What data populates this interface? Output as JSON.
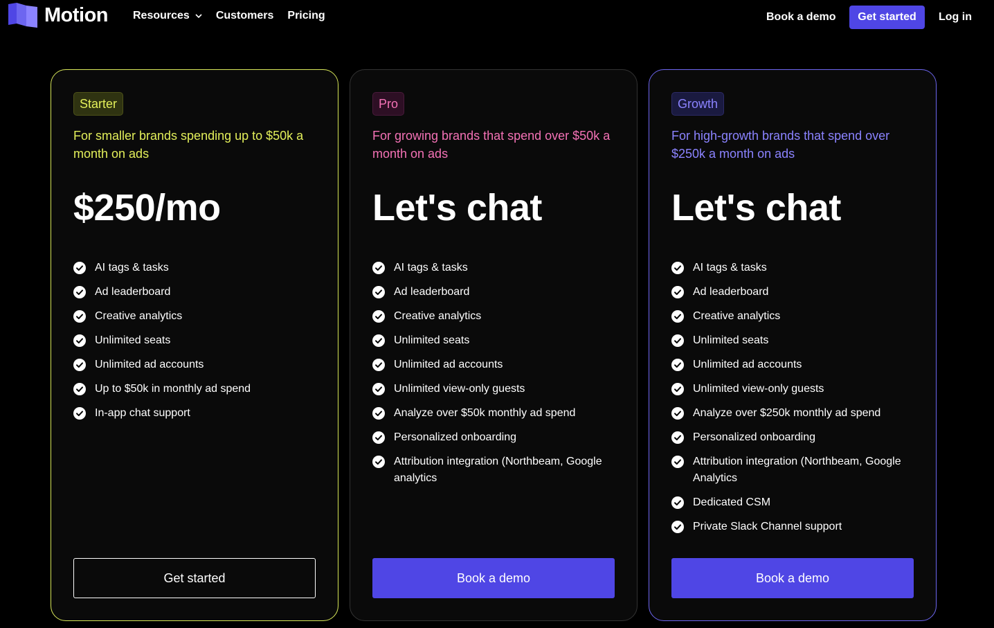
{
  "nav": {
    "logo_text": "Motion",
    "links": [
      {
        "label": "Resources",
        "has_dropdown": true
      },
      {
        "label": "Customers"
      },
      {
        "label": "Pricing"
      }
    ],
    "book_demo": "Book a demo",
    "get_started": "Get started",
    "login": "Log in",
    "accent_color": "#4f46e5"
  },
  "plans": [
    {
      "badge": "Starter",
      "description": "For smaller brands spending up to $50k a month on ads",
      "price": "$250/mo",
      "features": [
        "AI tags & tasks",
        "Ad leaderboard",
        "Creative analytics",
        "Unlimited seats",
        "Unlimited ad accounts",
        "Up to $50k in monthly ad spend",
        "In-app chat support"
      ],
      "cta": "Get started",
      "accent_color": "#e3ef5a"
    },
    {
      "badge": "Pro",
      "description": "For growing brands that spend over $50k a month on ads",
      "price": "Let's chat",
      "features": [
        "AI tags & tasks",
        "Ad leaderboard",
        "Creative analytics",
        "Unlimited seats",
        "Unlimited ad accounts",
        "Unlimited view-only guests",
        "Analyze over $50k monthly ad spend",
        "Personalized onboarding",
        "Attribution integration (Northbeam, Google analytics"
      ],
      "cta": "Book a demo",
      "accent_color": "#f472b6"
    },
    {
      "badge": "Growth",
      "description": "For high-growth brands that spend over $250k a month on ads",
      "price": "Let's chat",
      "features": [
        "AI tags & tasks",
        "Ad leaderboard",
        "Creative analytics",
        "Unlimited seats",
        "Unlimited ad accounts",
        "Unlimited view-only guests",
        "Analyze over $250k monthly ad spend",
        "Personalized onboarding",
        "Attribution integration (Northbeam, Google Analytics",
        "Dedicated CSM",
        "Private Slack Channel support"
      ],
      "cta": "Book a demo",
      "accent_color": "#8b83ff"
    }
  ]
}
